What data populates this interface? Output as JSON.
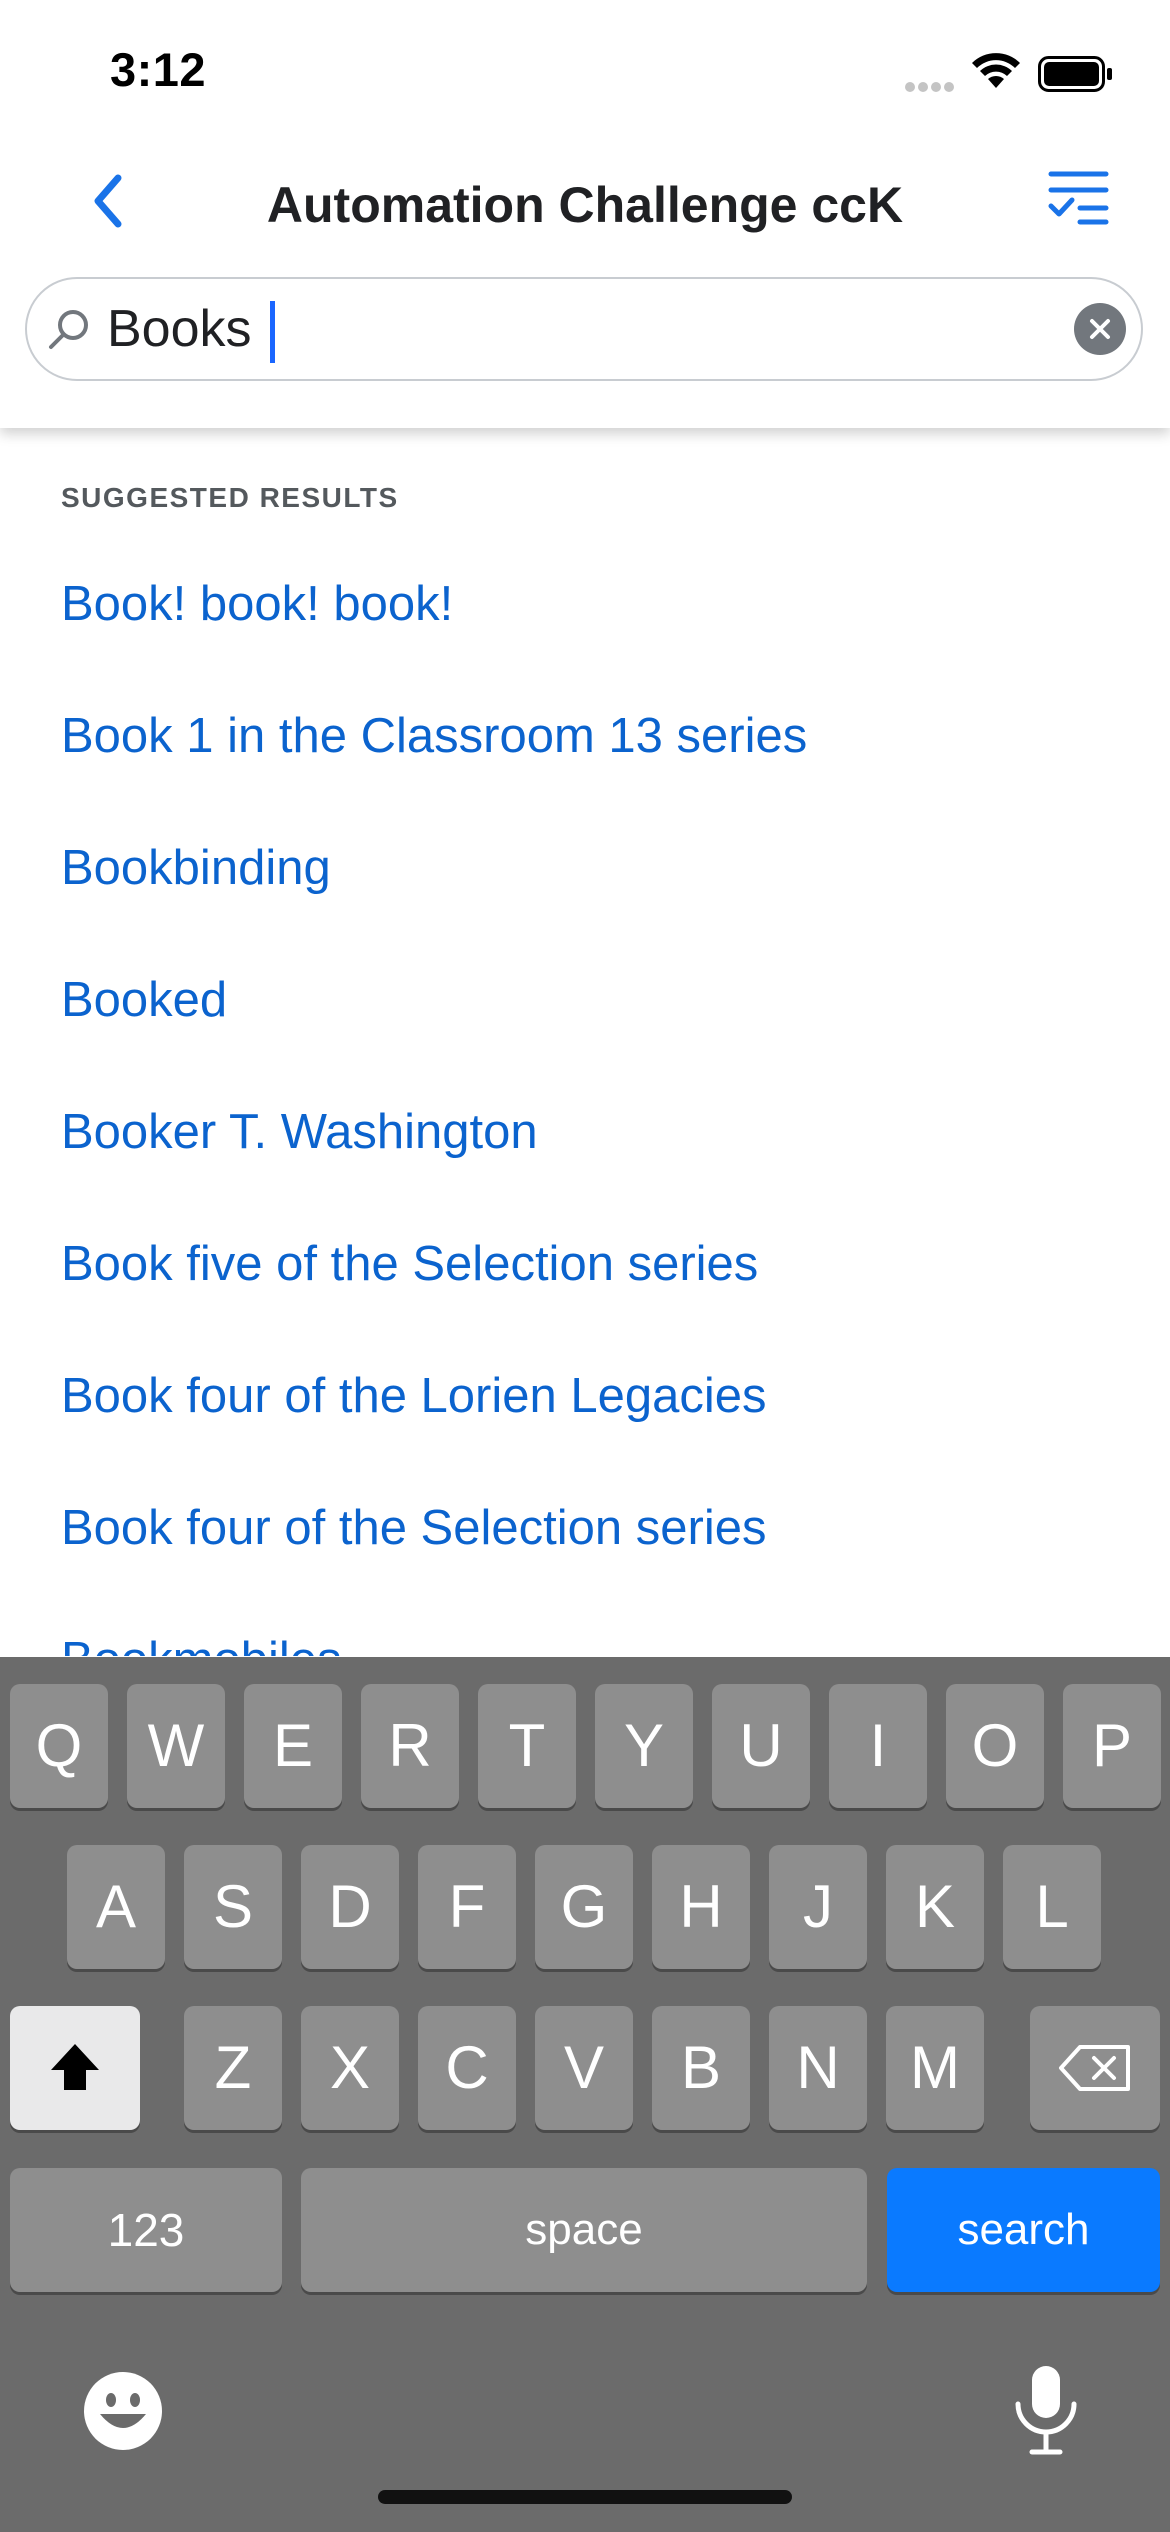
{
  "status_bar": {
    "time": "3:12"
  },
  "header": {
    "title": "Automation Challenge ccK"
  },
  "search": {
    "value": "Books"
  },
  "results": {
    "heading": "SUGGESTED RESULTS",
    "items": [
      "Book! book! book!",
      "Book 1 in the Classroom 13 series",
      "Bookbinding",
      "Booked",
      "Booker T. Washington",
      "Book five of the Selection series",
      "Book four of the Lorien Legacies",
      "Book four of the Selection series",
      "Bookmobiles"
    ]
  },
  "keyboard": {
    "row1": [
      "Q",
      "W",
      "E",
      "R",
      "T",
      "Y",
      "U",
      "I",
      "O",
      "P"
    ],
    "row2": [
      "A",
      "S",
      "D",
      "F",
      "G",
      "H",
      "J",
      "K",
      "L"
    ],
    "row3": [
      "Z",
      "X",
      "C",
      "V",
      "B",
      "N",
      "M"
    ],
    "numbers_label": "123",
    "space_label": "space",
    "search_label": "search"
  },
  "colors": {
    "accent": "#0a7aff",
    "link": "#0b63ce",
    "keyboard_bg": "#6b6b6b",
    "key_bg": "#8e8e8e"
  },
  "icons": [
    "back-chevron-icon",
    "filter-list-icon",
    "search-icon",
    "clear-icon",
    "shift-icon",
    "delete-icon",
    "emoji-icon",
    "microphone-icon",
    "wifi-icon",
    "battery-icon",
    "cellular-signal-icon"
  ]
}
